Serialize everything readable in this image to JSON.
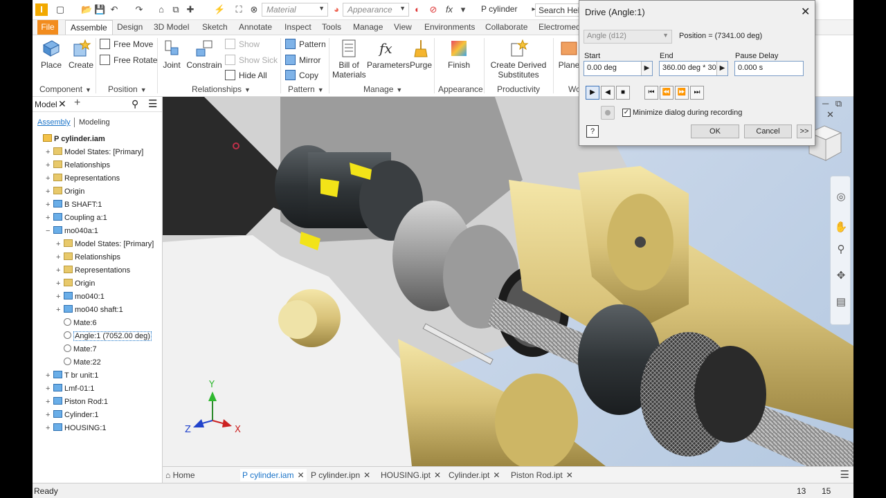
{
  "qat": {
    "material_placeholder": "Material",
    "appearance_placeholder": "Appearance",
    "doc_title": "P cylinder",
    "search": "Search Help"
  },
  "tabs": [
    "File",
    "Assemble",
    "Design",
    "3D Model",
    "Sketch",
    "Annotate",
    "Inspect",
    "Tools",
    "Manage",
    "View",
    "Environments",
    "Collaborate",
    "Electromech"
  ],
  "ribbon": {
    "place": "Place",
    "create": "Create",
    "free_move": "Free Move",
    "free_rotate": "Free Rotate",
    "joint": "Joint",
    "constrain": "Constrain",
    "show": "Show",
    "show_sick": "Show Sick",
    "hide_all": "Hide All",
    "pattern": "Pattern",
    "mirror": "Mirror",
    "copy": "Copy",
    "bill_of_materials_1": "Bill of",
    "bill_of_materials_2": "Materials",
    "parameters": "Parameters",
    "purge": "Purge",
    "finish": "Finish",
    "create_derived_1": "Create Derived",
    "create_derived_2": "Substitutes",
    "plane": "Plane",
    "groups": {
      "component": "Component",
      "position": "Position",
      "relationships": "Relationships",
      "pattern": "Pattern",
      "manage": "Manage",
      "appearance": "Appearance",
      "productivity": "Productivity",
      "work": "Wo"
    }
  },
  "browser": {
    "title": "Model",
    "assembly_tab": "Assembly",
    "modeling_tab": "Modeling",
    "nodes": [
      {
        "label": "P cylinder.iam",
        "indent": 0,
        "icon": "asm",
        "exp": ""
      },
      {
        "label": "Model States: [Primary]",
        "indent": 1,
        "icon": "folder",
        "exp": "+"
      },
      {
        "label": "Relationships",
        "indent": 1,
        "icon": "folder",
        "exp": "+"
      },
      {
        "label": "Representations",
        "indent": 1,
        "icon": "folder",
        "exp": "+"
      },
      {
        "label": "Origin",
        "indent": 1,
        "icon": "folder",
        "exp": "+"
      },
      {
        "label": "B SHAFT:1",
        "indent": 1,
        "icon": "part",
        "exp": "+"
      },
      {
        "label": "Coupling a:1",
        "indent": 1,
        "icon": "part",
        "exp": "+"
      },
      {
        "label": "mo040a:1",
        "indent": 1,
        "icon": "part",
        "exp": "−"
      },
      {
        "label": "Model States: [Primary]",
        "indent": 2,
        "icon": "folder",
        "exp": "+"
      },
      {
        "label": "Relationships",
        "indent": 2,
        "icon": "folder",
        "exp": "+"
      },
      {
        "label": "Representations",
        "indent": 2,
        "icon": "folder",
        "exp": "+"
      },
      {
        "label": "Origin",
        "indent": 2,
        "icon": "folder",
        "exp": "+"
      },
      {
        "label": "mo040:1",
        "indent": 2,
        "icon": "part",
        "exp": "+"
      },
      {
        "label": "mo040 shaft:1",
        "indent": 2,
        "icon": "part",
        "exp": "+"
      },
      {
        "label": "Mate:6",
        "indent": 2,
        "icon": "mate",
        "exp": ""
      },
      {
        "label": "Angle:1 (7052.00 deg)",
        "indent": 2,
        "icon": "mate",
        "exp": "",
        "selected": true
      },
      {
        "label": "Mate:7",
        "indent": 2,
        "icon": "mate",
        "exp": ""
      },
      {
        "label": "Mate:22",
        "indent": 2,
        "icon": "mate",
        "exp": ""
      },
      {
        "label": "T br unit:1",
        "indent": 1,
        "icon": "part",
        "exp": "+"
      },
      {
        "label": "Lmf-01:1",
        "indent": 1,
        "icon": "part",
        "exp": "+"
      },
      {
        "label": "Piston Rod:1",
        "indent": 1,
        "icon": "part",
        "exp": "+"
      },
      {
        "label": "Cylinder:1",
        "indent": 1,
        "icon": "part",
        "exp": "+"
      },
      {
        "label": "HOUSING:1",
        "indent": 1,
        "icon": "part",
        "exp": "+"
      }
    ]
  },
  "doc_tabs": {
    "home": "Home",
    "items": [
      "P cylinder.iam",
      "P cylinder.ipn",
      "HOUSING.ipt",
      "Cylinder.ipt",
      "Piston Rod.ipt"
    ]
  },
  "status": {
    "text": "Ready",
    "num1": "13",
    "num2": "15"
  },
  "axes": {
    "x": "X",
    "y": "Y",
    "z": "Z"
  },
  "dialog": {
    "title": "Drive (Angle:1)",
    "parameter": "Angle (d12)",
    "position": "Position = (7341.00 deg)",
    "start_label": "Start",
    "start_value": "0.00 deg",
    "end_label": "End",
    "end_value": "360.00 deg * 30.",
    "pause_label": "Pause Delay",
    "pause_value": "0.000 s",
    "minimize_label": "Minimize dialog during recording",
    "minimize_checked": true,
    "ok": "OK",
    "cancel": "Cancel",
    "more": ">>",
    "help": "?"
  },
  "colors": {
    "file_tab": "#f28c1e",
    "brass": "#d9c37a",
    "accent_yellow": "#f2e318",
    "link_blue": "#1a73c8"
  }
}
